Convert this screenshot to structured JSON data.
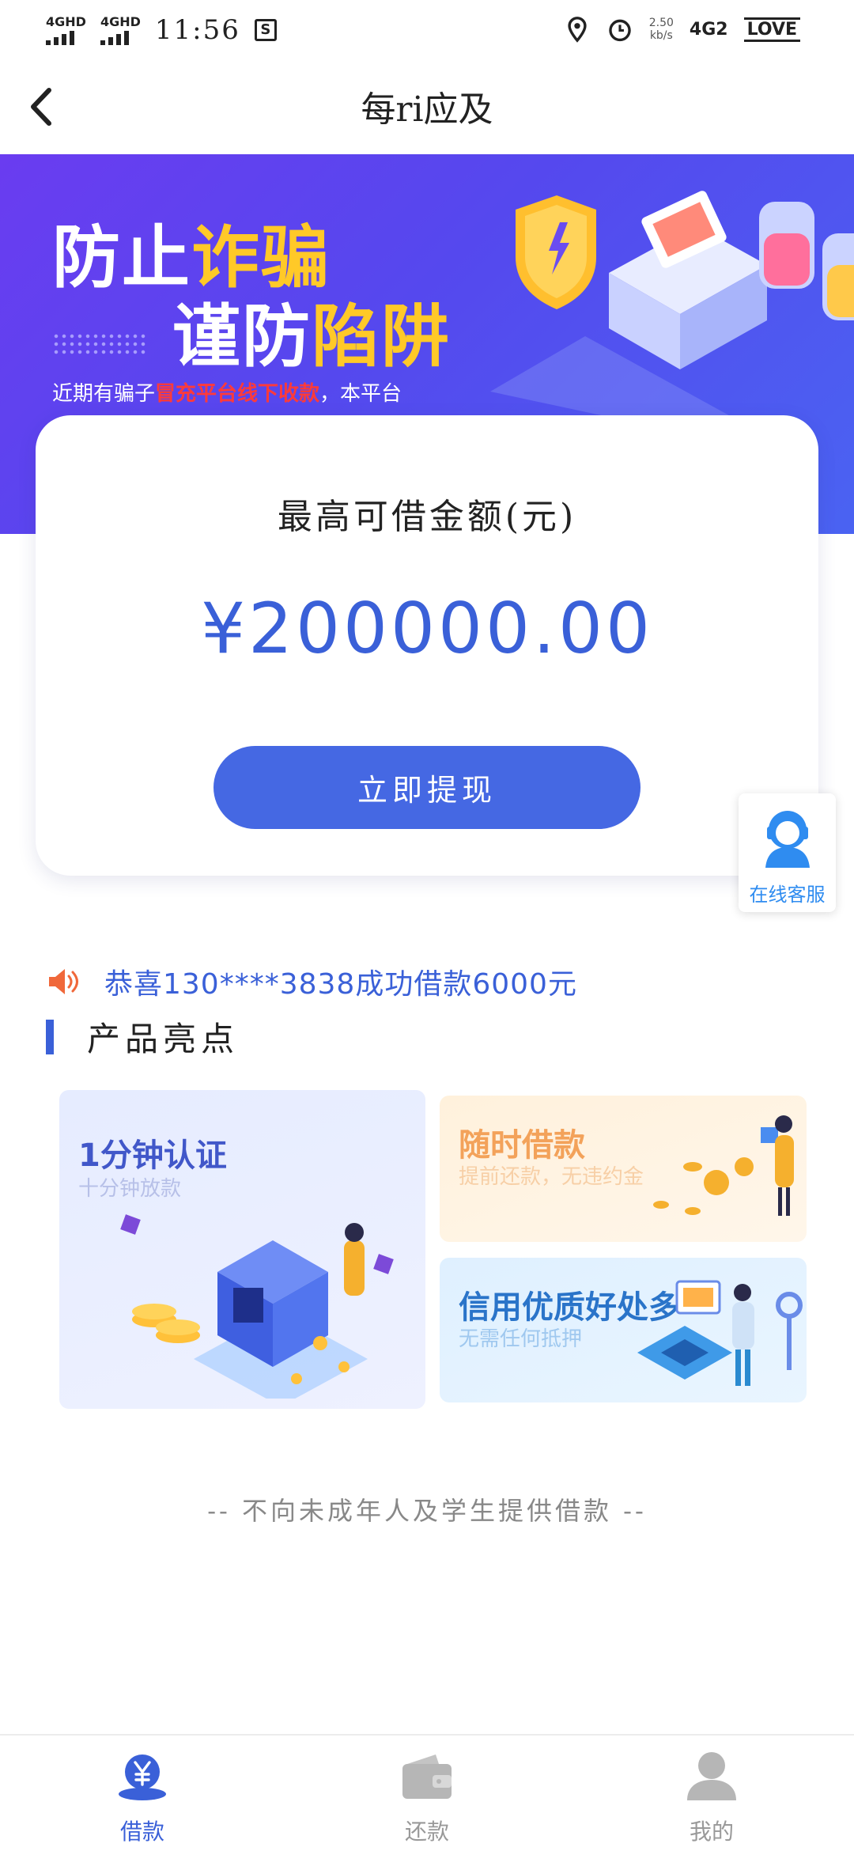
{
  "status_bar": {
    "sim1": "4GHD",
    "sim2": "4GHD",
    "time": "11:56",
    "speed_value": "2.50",
    "speed_unit": "kb/s",
    "network": "4G2",
    "love": "LOVE"
  },
  "header": {
    "title": "每ri应及"
  },
  "banner": {
    "line1_a": "防止",
    "line1_b": "诈骗",
    "line2_a": "谨防",
    "line2_b": "陷阱",
    "notice_a": "近期有骗子",
    "notice_b": "冒充平台线下收款",
    "notice_c": "，本平台"
  },
  "card": {
    "label": "最高可借金额(元)",
    "amount": "¥200000.00",
    "button": "立即提现"
  },
  "customer_service": {
    "label": "在线客服"
  },
  "marquee": {
    "text": "恭喜130****3838成功借款6000元"
  },
  "section": {
    "title": "产品亮点"
  },
  "features": [
    {
      "title": "1分钟认证",
      "subtitle": "十分钟放款"
    },
    {
      "title": "随时借款",
      "subtitle": "提前还款，无违约金"
    },
    {
      "title": "信用优质好处多",
      "subtitle": "无需任何抵押"
    }
  ],
  "disclaimer": "-- 不向未成年人及学生提供借款 --",
  "tabs": [
    {
      "label": "借款",
      "active": true
    },
    {
      "label": "还款",
      "active": false
    },
    {
      "label": "我的",
      "active": false
    }
  ],
  "colors": {
    "accent": "#4568e3",
    "banner": "#5548ee",
    "cs_blue": "#2f8cf0"
  }
}
